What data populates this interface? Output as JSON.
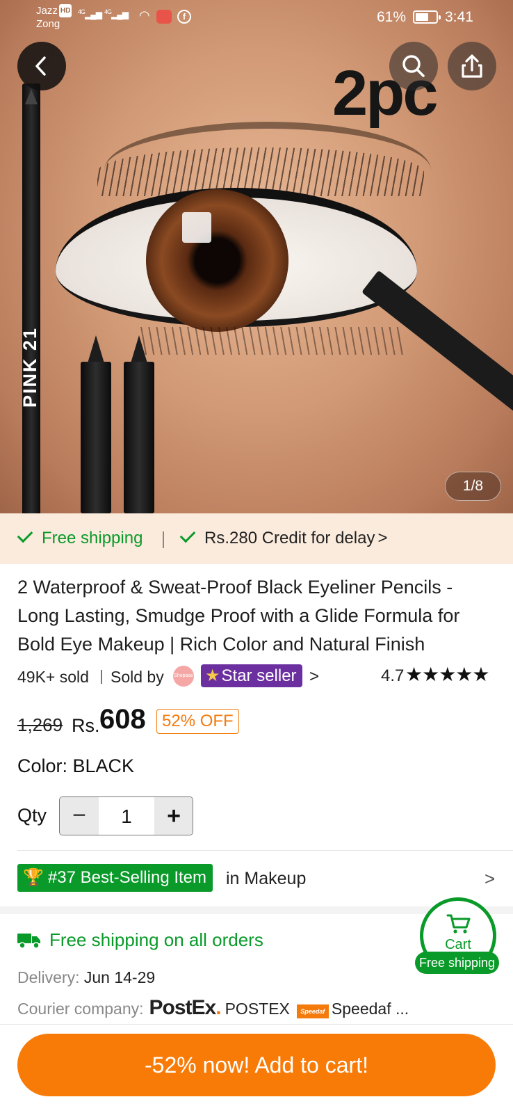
{
  "status_bar": {
    "carrier_1": "Jazz",
    "carrier_1_badge": "HD",
    "carrier_2": "Zong",
    "network_1": "4G",
    "network_2": "4G",
    "battery": "61%",
    "time": "3:41",
    "icons": [
      "signal-icon",
      "wifi-icon",
      "app-notification-icon",
      "facebook-icon",
      "battery-charging-icon"
    ]
  },
  "header": {
    "back_icon": "chevron-left-icon",
    "search_icon": "search-icon",
    "share_icon": "share-icon"
  },
  "gallery": {
    "page_indicator": "1/8",
    "image_overlay_text": "2pc",
    "pencil_label": "PINK 21"
  },
  "shipping_strip": {
    "free_shipping": "Free shipping",
    "credit": "Rs.280 Credit for delay",
    "credit_chevron": ">"
  },
  "product": {
    "title": "2 Waterproof & Sweat-Proof Black Eyeliner Pencils - Long Lasting, Smudge Proof with a Glide Formula for Bold Eye Makeup | Rich Color and Natural Finish",
    "sold": "49K+ sold",
    "sold_by": "Sold by",
    "seller_logo_text": "Shopaas",
    "seller_badge": "Star seller",
    "seller_chevron": ">",
    "rating": "4.7",
    "rating_stars": 4.7,
    "stars_glyph": "★★★★★",
    "old_price": "1,269",
    "currency": "Rs.",
    "price": "608",
    "discount": "52% OFF",
    "color_label": "Color: BLACK",
    "qty_label": "Qty",
    "qty_value": "1",
    "qty_minus": "−",
    "qty_plus": "+"
  },
  "best_selling": {
    "badge": "#37 Best-Selling Item",
    "category": "in Makeup",
    "chevron": ">"
  },
  "shipping_info": {
    "title": "Free shipping on all orders",
    "delivery_label": "Delivery:",
    "delivery_value": "Jun 14-29",
    "courier_label": "Courier company:",
    "postex_logo": "PostEx",
    "postex_name": "POSTEX",
    "speedaf_logo": "Speedaf",
    "speedaf_name": "Speedaf ..."
  },
  "cart_fab": {
    "label": "Cart",
    "pill": "Free shipping"
  },
  "cta": {
    "label": "-52% now! Add to cart!"
  },
  "colors": {
    "accent_orange": "#f97b07",
    "success_green": "#0a9a2a",
    "star_seller_purple": "#6b2fa0",
    "strip_background": "#fbebdd"
  }
}
